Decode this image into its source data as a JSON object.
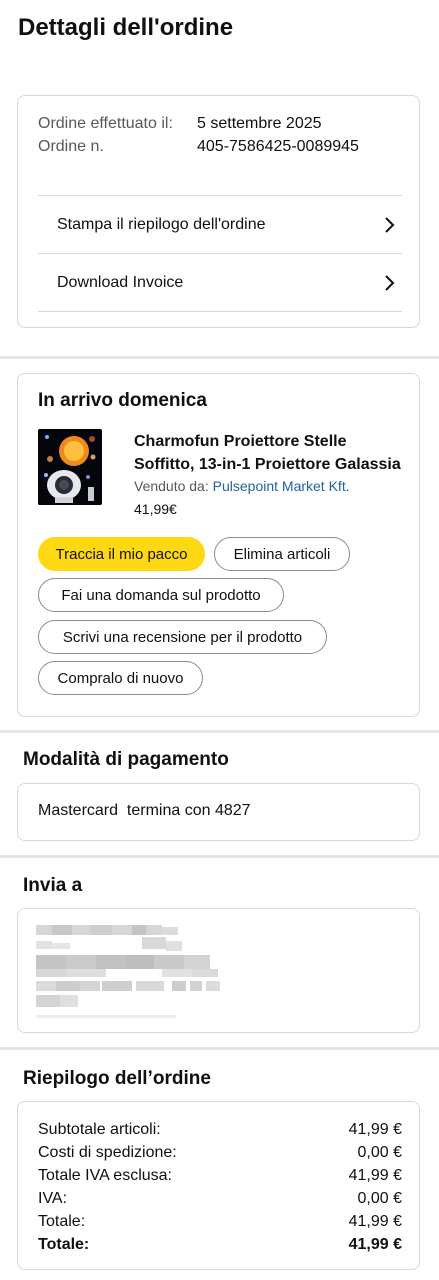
{
  "page": {
    "title": "Dettagli dell'ordine"
  },
  "order_info": {
    "placed_label": "Ordine effettuato il:",
    "number_label": "Ordine n.",
    "placed_value": "5 settembre 2025",
    "number_value": "405-7586425-0089945",
    "links": [
      {
        "label": "Stampa il riepilogo dell'ordine",
        "icon": "chevron-right-icon"
      },
      {
        "label": "Download Invoice",
        "icon": "chevron-right-icon"
      }
    ]
  },
  "delivery": {
    "title": "In arrivo domenica",
    "product": {
      "title": "Charmofun Proiettore Stelle Soffitto, 13-in-1 Proiettore Galassia",
      "sold_by_label": "Venduto da:",
      "seller": "Pulsepoint Market Kft.",
      "price": "41,99€"
    },
    "buttons": {
      "track": "Traccia il mio pacco",
      "remove": "Elimina articoli",
      "ask": "Fai una domanda sul prodotto",
      "review": "Scrivi una recensione per il prodotto",
      "buy_again": "Compralo di nuovo"
    },
    "colors": {
      "primary_button": "#ffd814",
      "link": "#2162a1"
    }
  },
  "payment": {
    "title": "Modalità di pagamento",
    "method": "Mastercard  termina con 4827"
  },
  "shipping": {
    "title": "Invia a"
  },
  "summary": {
    "title": "Riepilogo dell’ordine",
    "rows": [
      {
        "label": "Subtotale articoli:",
        "value": "41,99 €"
      },
      {
        "label": "Costi di spedizione:",
        "value": "0,00 €"
      },
      {
        "label": "Totale IVA esclusa:",
        "value": "41,99 €"
      },
      {
        "label": "IVA:",
        "value": "0,00 €"
      },
      {
        "label": "Totale:",
        "value": "41,99 €"
      }
    ],
    "grand_total": {
      "label": "Totale:",
      "value": "41,99 €"
    }
  }
}
